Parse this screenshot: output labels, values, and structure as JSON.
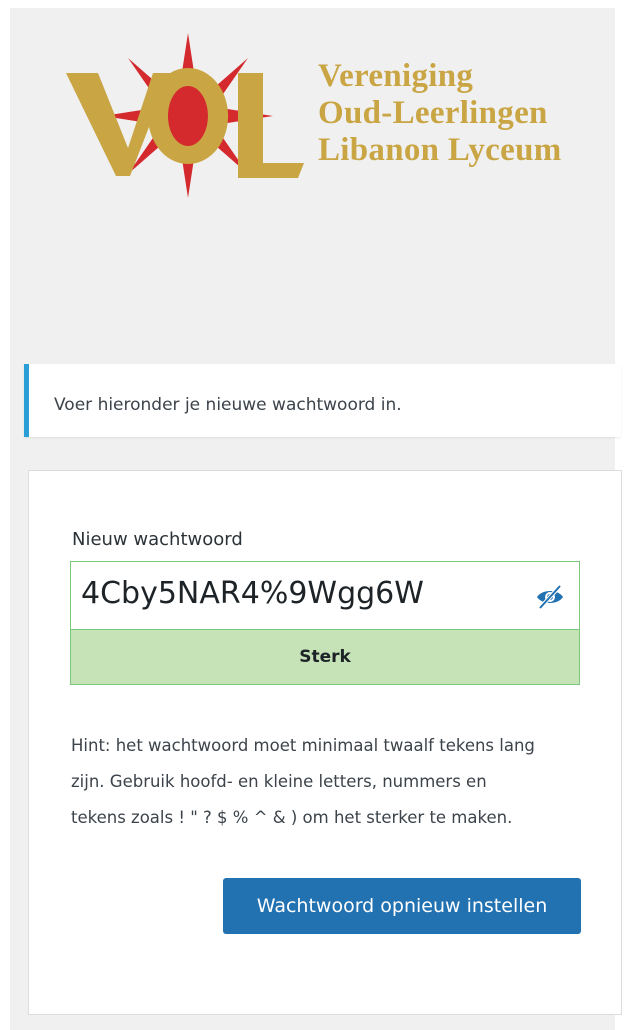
{
  "logo": {
    "letters": "VOL",
    "line1": "Vereniging",
    "line2": "Oud-Leerlingen",
    "line3": "Libanon Lyceum",
    "gold_color": "#c9a544",
    "red_color": "#d42a2e"
  },
  "message": {
    "text": "Voer hieronder je nieuwe wachtwoord in."
  },
  "form": {
    "password_label": "Nieuw wachtwoord",
    "password_value": "4Cby5NAR4%9Wgg6W",
    "toggle_icon": "eye-slash-icon",
    "strength_label": "Sterk",
    "hint": "Hint: het wachtwoord moet minimaal twaalf tekens lang zijn. Gebruik hoofd- en kleine letters, nummers en tekens zoals ! \" ? $ % ^ & ) om het sterker te maken.",
    "submit_label": "Wachtwoord opnieuw instellen"
  },
  "colors": {
    "accent": "#2271b1",
    "notice_border": "#2a9ed6",
    "strength_bg": "#c6e3b8",
    "strength_border": "#7bc77c"
  }
}
